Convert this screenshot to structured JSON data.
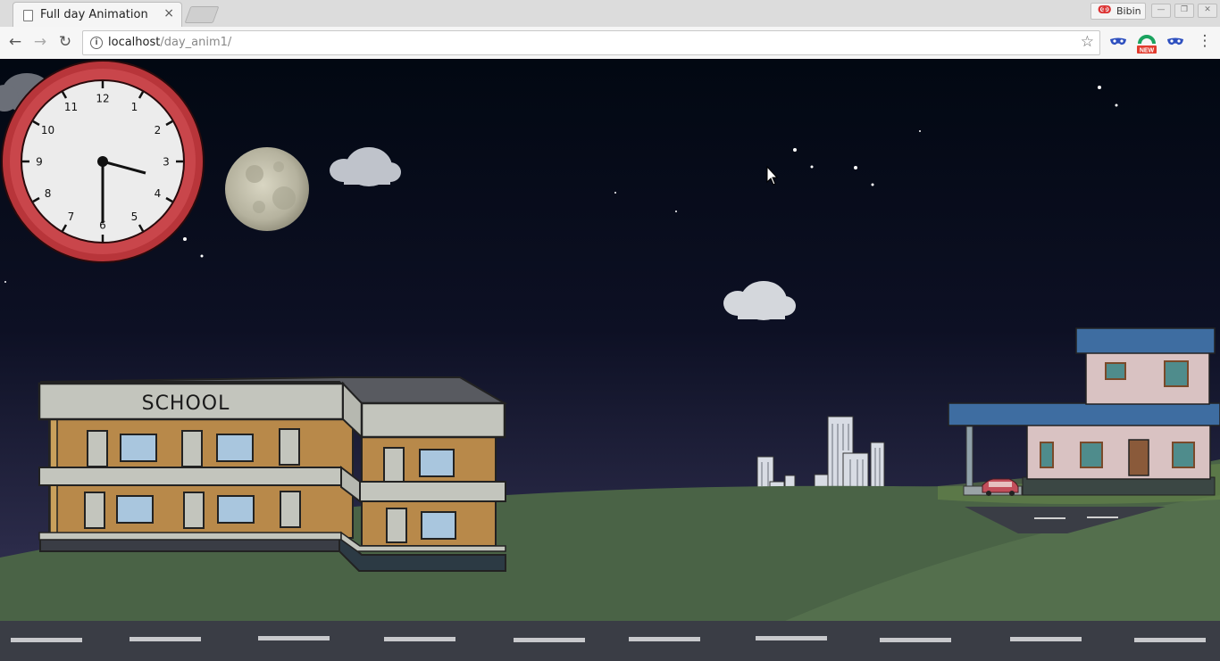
{
  "tab": {
    "title": "Full day Animation",
    "close_label": "×"
  },
  "profile": {
    "name": "Bibin"
  },
  "navbar": {
    "url_host": "localhost",
    "url_path": "/day_anim1/",
    "back_label": "←",
    "forward_label": "→",
    "reload_label": "↻",
    "star_label": "☆",
    "menu_label": "⋮"
  },
  "scene": {
    "sky_color": "#020812",
    "grass_color": "#4a6346",
    "road_color": "#3a3d45",
    "school_label": "SCHOOL",
    "extension_badge": "NEW",
    "clock": {
      "numerals": [
        "12",
        "1",
        "2",
        "3",
        "4",
        "5",
        "6",
        "7",
        "8",
        "9",
        "10",
        "11"
      ],
      "time_shown": "3:30",
      "frame_color": "#b8353a"
    }
  }
}
